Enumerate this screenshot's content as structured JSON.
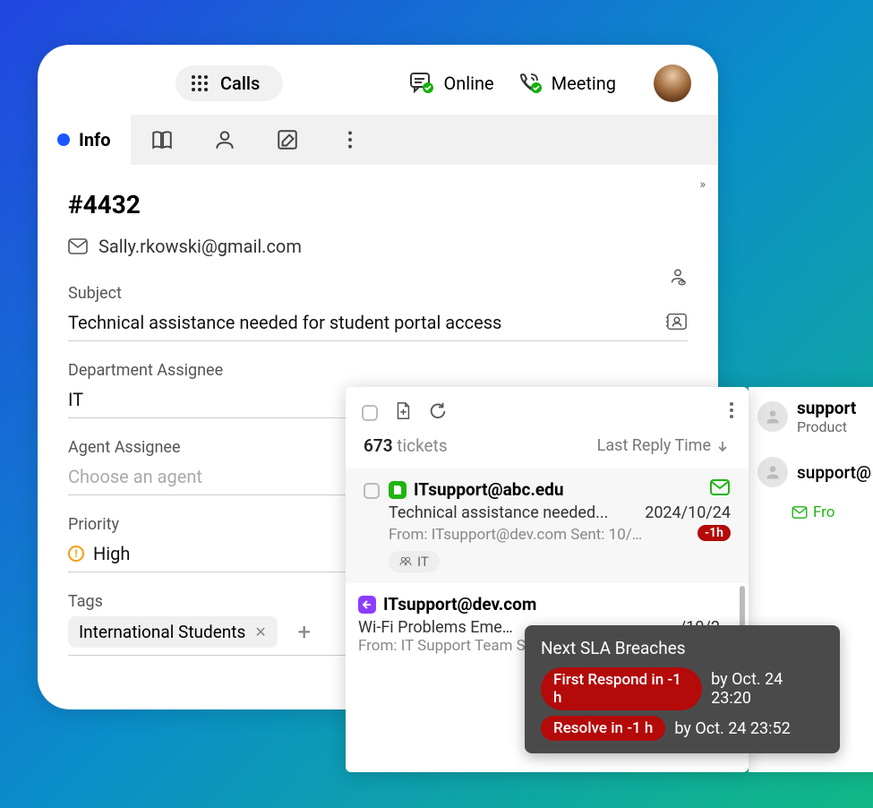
{
  "topbar": {
    "calls_label": "Calls",
    "online_label": "Online",
    "meeting_label": "Meeting"
  },
  "tabs": {
    "info_label": "Info"
  },
  "ticket": {
    "id": "#4432",
    "email": "Sally.rkowski@gmail.com",
    "subject_label": "Subject",
    "subject_value": "Technical assistance needed for student portal access",
    "dept_label": "Department Assignee",
    "dept_value": "IT",
    "agent_label": "Agent Assignee",
    "agent_placeholder": "Choose an agent",
    "priority_label": "Priority",
    "priority_value": "High",
    "tags_label": "Tags",
    "tag_value": "International Students"
  },
  "list": {
    "count": "673",
    "count_suffix": "tickets",
    "sort_label": "Last Reply Time",
    "items": [
      {
        "from": "ITsupport@abc.edu",
        "subject": "Technical assistance needed...",
        "date": "2024/10/24",
        "meta": "From: ITsupport@dev.com Sent: 10/…",
        "sla": "-1h",
        "dept": "IT",
        "source": "web"
      },
      {
        "from": "ITsupport@dev.com",
        "subject": "Wi-Fi Problems Eme…",
        "date": "/10/2…",
        "meta": "From: IT Support Team Sent: 10/24/…",
        "source": "reply"
      }
    ]
  },
  "sla": {
    "title": "Next SLA Breaches",
    "rows": [
      {
        "badge": "First Respond in -1 h",
        "time": "by Oct. 24 23:20"
      },
      {
        "badge": "Resolve in -1 h",
        "time": "by Oct. 24 23:52"
      }
    ]
  },
  "right": {
    "name1": "support",
    "sub1": "Product",
    "name2": "support@",
    "msg_label": "Fro"
  }
}
